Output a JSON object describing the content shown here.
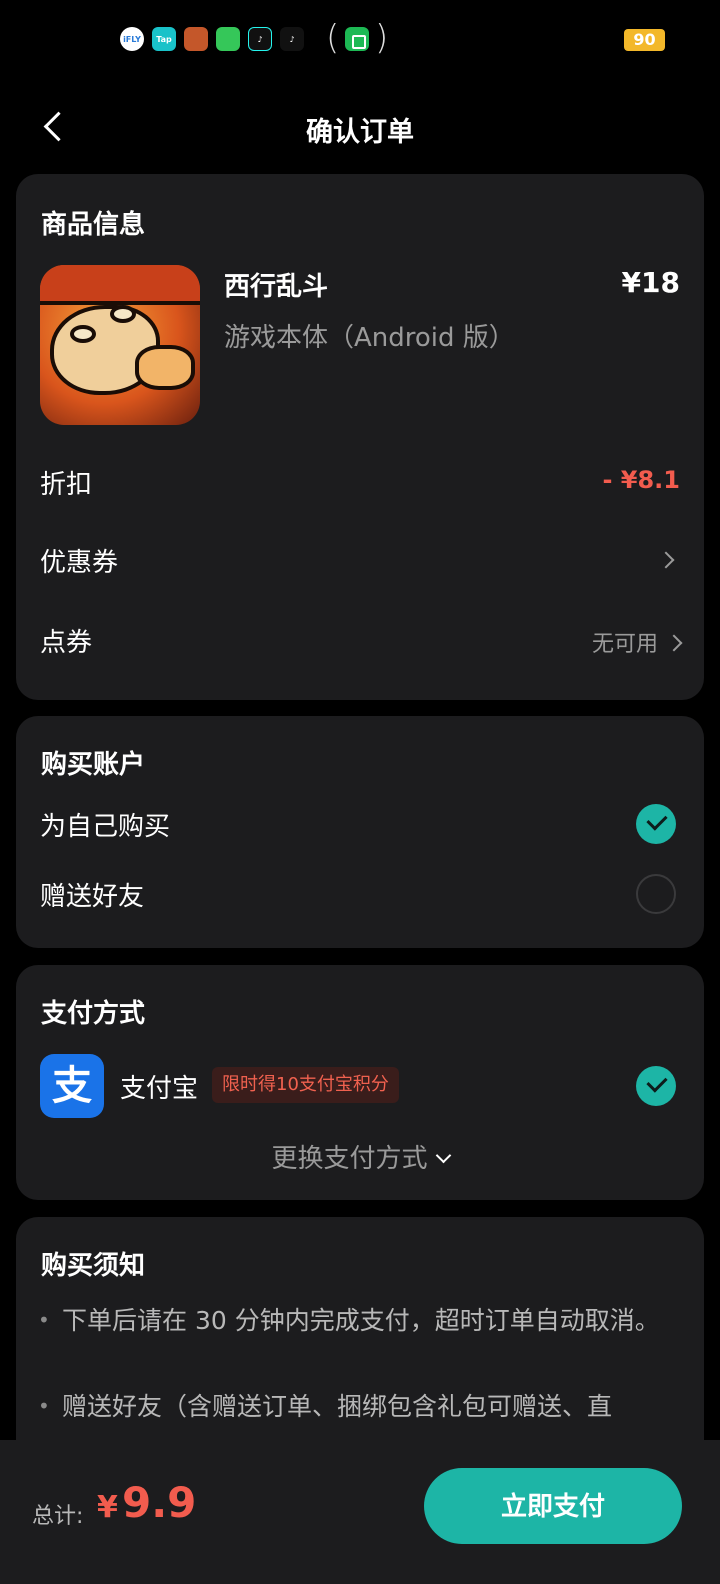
{
  "status_bar": {
    "icons": [
      "iflytek-icon",
      "taptap-icon",
      "game-icon",
      "messages-icon",
      "tiktok-icon",
      "tiktok-icon-2",
      "app-store-icon"
    ],
    "battery": "90"
  },
  "header": {
    "title": "确认订单"
  },
  "product": {
    "section_title": "商品信息",
    "name": "西行乱斗",
    "subtitle": "游戏本体（Android 版）",
    "price": "¥18",
    "discount_label": "折扣",
    "discount_value": "- ¥8.1",
    "coupon_label": "优惠券",
    "points_coupon_label": "点券",
    "points_coupon_value": "无可用"
  },
  "account": {
    "section_title": "购买账户",
    "options": [
      {
        "label": "为自己购买",
        "selected": true
      },
      {
        "label": "赠送好友",
        "selected": false
      }
    ]
  },
  "payment": {
    "section_title": "支付方式",
    "method_icon_text": "支",
    "method_name": "支付宝",
    "promo": "限时得10支付宝积分",
    "change_label": "更换支付方式"
  },
  "notice": {
    "section_title": "购买须知",
    "items": [
      "下单后请在 30 分钟内完成支付，超时订单自动取消。",
      "赠送好友（含赠送订单、捆绑包含礼包可赠送、直"
    ]
  },
  "footer": {
    "total_label": "总计:",
    "currency": "¥",
    "total_value": "9.9",
    "pay_button": "立即支付"
  },
  "colors": {
    "accent": "#1db5a6",
    "discount": "#f25c4e",
    "card": "#1c1c1e",
    "background": "#000000"
  }
}
